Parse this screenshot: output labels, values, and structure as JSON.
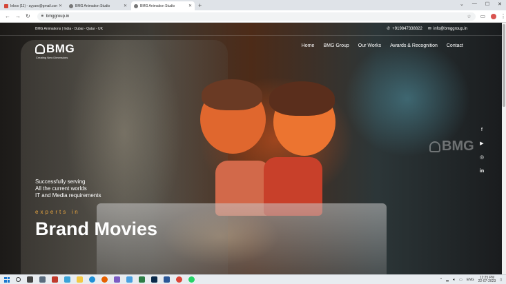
{
  "browser": {
    "tabs": [
      {
        "title": "Inbox (11) - ayyaro@gmail.com",
        "favicon_color": "#d44638",
        "active": false
      },
      {
        "title": "BMG Animation Studio",
        "favicon_color": "#555555",
        "active": false
      },
      {
        "title": "BMG Animation Studio",
        "favicon_color": "#555555",
        "active": true
      }
    ],
    "new_tab": "+",
    "url": "bmggroup.in"
  },
  "site": {
    "location_line": "BMG Animations | India - Dubai - Qatar - UK",
    "phone": "+919847338822",
    "email": "info@bmggroup.in",
    "logo_text": "BMG",
    "logo_tagline": "Creating New Dimensions",
    "nav": [
      "Home",
      "BMG Group",
      "Our Works",
      "Awards & Recognition",
      "Contact"
    ],
    "social_icons": [
      "facebook-icon",
      "youtube-icon",
      "instagram-icon",
      "linkedin-icon"
    ],
    "watermark": "BMG",
    "intro_lines": [
      "Successfully serving",
      "All the current worlds",
      "IT and Media requirements"
    ],
    "experts_text": "experts in",
    "headline": "Brand Movies",
    "accent_color": "#e8a640"
  },
  "taskbar": {
    "language": "ENG",
    "time": "12:25 PM",
    "date": "22-07-2023"
  }
}
